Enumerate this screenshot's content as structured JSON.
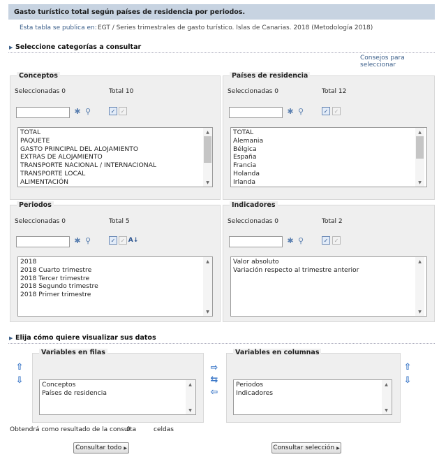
{
  "title": "Gasto turístico total según países de residencia por periodos.",
  "publication": {
    "label": "Esta tabla se publica en:",
    "value": "EGT / Series trimestrales de gasto turístico. Islas de Canarias. 2018 (Metodología 2018)"
  },
  "section_select": "Seleccione categorías a consultar",
  "advice_link": "Consejos para seleccionar",
  "panels": {
    "conceptos": {
      "legend": "Conceptos",
      "selected": "Seleccionadas 0",
      "total": "Total 10",
      "items": [
        "TOTAL",
        "PAQUETE",
        "GASTO PRINCIPAL DEL ALOJAMIENTO",
        "EXTRAS DE ALOJAMIENTO",
        "TRANSPORTE NACIONAL / INTERNACIONAL",
        "TRANSPORTE LOCAL",
        "ALIMENTACIÓN"
      ]
    },
    "paises": {
      "legend": "Países de residencia",
      "selected": "Seleccionadas 0",
      "total": "Total 12",
      "items": [
        "TOTAL",
        "Alemania",
        "Bélgica",
        "España",
        "Francia",
        "Holanda",
        "Irlanda"
      ]
    },
    "periodos": {
      "legend": "Periodos",
      "selected": "Seleccionadas 0",
      "total": "Total 5",
      "items": [
        "2018",
        "2018 Cuarto trimestre",
        "2018 Tercer trimestre",
        "2018 Segundo trimestre",
        "2018 Primer trimestre"
      ]
    },
    "indicadores": {
      "legend": "Indicadores",
      "selected": "Seleccionadas 0",
      "total": "Total 2",
      "items": [
        "Valor absoluto",
        "Variación respecto al trimestre anterior"
      ]
    }
  },
  "section_visualize": "Elija cómo quiere visualizar sus datos",
  "rows_panel": {
    "legend": "Variables en filas",
    "items": [
      "Conceptos",
      "Países de residencia"
    ]
  },
  "cols_panel": {
    "legend": "Variables en columnas",
    "items": [
      "Periodos",
      "Indicadores"
    ]
  },
  "result": {
    "prefix": "Obtendrá como resultado de la consulta",
    "count": "0",
    "suffix": "celdas"
  },
  "buttons": {
    "consult_all": "Consultar todo",
    "consult_selection": "Consultar selección"
  }
}
